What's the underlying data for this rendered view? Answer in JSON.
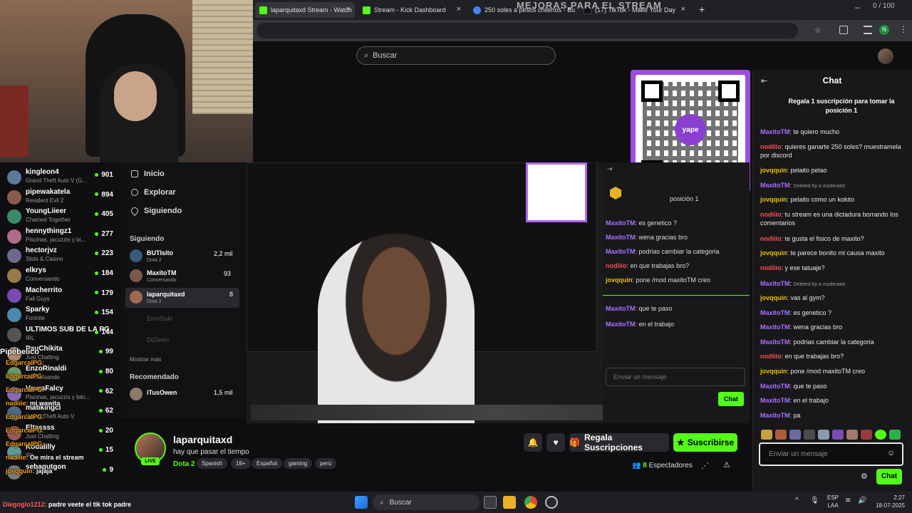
{
  "browser": {
    "tabs": [
      {
        "label": "laparquitaxd Stream - Watch",
        "color": "#53fc18"
      },
      {
        "label": "Stream - Kick Dashboard",
        "color": "#53fc18"
      },
      {
        "label": "250 soles a pesos chilenos - Bu",
        "color": "#4285f4"
      },
      {
        "label": "(17) TikTok - Make Your Day",
        "color": "#000000"
      }
    ],
    "overlay_text": "MEJORAS PARA EL STREAM",
    "window_counter": "0 / 100"
  },
  "kick": {
    "search_placeholder": "Buscar",
    "chat_title": "Chat",
    "pinned": "Regala 1 suscripción para tomar la posición 1",
    "pinned_rank": "1",
    "chat_messages": [
      {
        "user": "MaxitoTM",
        "color": "#a970ff",
        "text": "te quiero mucho"
      },
      {
        "user": "nodiiio",
        "color": "#ff4d4d",
        "text": "quieres ganarte 250 soles? muestramela por discord"
      },
      {
        "user": "jovqquin",
        "color": "#e8c200",
        "text": "pelaito pelao"
      },
      {
        "user": "MaxitoTM",
        "color": "#a970ff",
        "text": "Deleted by a moderator",
        "mod": true
      },
      {
        "user": "jovqquin",
        "color": "#e8c200",
        "text": "pelaito como un kokito"
      },
      {
        "user": "nodiiio",
        "color": "#ff4d4d",
        "text": "tu stream es una dictadura borrando los comentarios"
      },
      {
        "user": "nodiiio",
        "color": "#ff4d4d",
        "text": "te gusta el fisico de maxito?"
      },
      {
        "user": "jovqquin",
        "color": "#e8c200",
        "text": "te parece bonito mi causa maxito"
      },
      {
        "user": "nodiiio",
        "color": "#ff4d4d",
        "text": "y ese tatuaje?"
      },
      {
        "user": "MaxitoTM",
        "color": "#a970ff",
        "text": "Deleted by a moderator",
        "mod": true
      },
      {
        "user": "jovqquin",
        "color": "#e8c200",
        "text": "vas al gym?"
      },
      {
        "user": "MaxitoTM",
        "color": "#a970ff",
        "text": "es genetico ?"
      },
      {
        "user": "MaxitoTM",
        "color": "#a970ff",
        "text": "wena gracias bro"
      },
      {
        "user": "MaxitoTM",
        "color": "#a970ff",
        "text": "podrias cambiar la categoria"
      },
      {
        "user": "nodiiio",
        "color": "#ff4d4d",
        "text": "en que trabajas bro?"
      },
      {
        "user": "jovqquin",
        "color": "#e8c200",
        "text": "pone /mod maxitoTM creo"
      },
      {
        "user": "MaxitoTM",
        "color": "#a970ff",
        "text": "que te paso"
      },
      {
        "user": "MaxitoTM",
        "color": "#a970ff",
        "text": "en el trabajo"
      },
      {
        "user": "MaxitoTM",
        "color": "#a970ff",
        "text": "pa"
      }
    ],
    "chat_input_placeholder": "Enviar un mensaje",
    "chat_send_label": "Chat",
    "streamer": {
      "name": "laparquitaxd",
      "title": "hay que pasar el tiempo",
      "category": "Dota 2",
      "tags": [
        "Spanish",
        "18+",
        "Español",
        "gaming",
        "perú"
      ],
      "live": "LIVE",
      "viewers": "8",
      "viewers_label": "Espectadores"
    },
    "gift_label": "Regala Suscripciones",
    "subscribe_label": "Suscribirse",
    "nav": [
      "Inicio",
      "Explorar",
      "Siguiendo"
    ],
    "following_header": "Siguiendo",
    "following": [
      {
        "name": "BUTIsito",
        "sub": "Dota 2",
        "count": "2,2 mil"
      },
      {
        "name": "MaxitoTM",
        "sub": "Conversando",
        "count": "93"
      },
      {
        "name": "laparquitaxd",
        "sub": "Dota 2",
        "count": "8"
      }
    ],
    "offline": [
      "EmoSuki",
      "DiZeein"
    ],
    "show_more": "Mostrar más",
    "recommended_header": "Recomendado",
    "recommended": [
      {
        "name": "iTusOwen",
        "count": "1,5 mil"
      }
    ],
    "qr_position": "posición 1",
    "qr_logo": "yape"
  },
  "follow_list": [
    {
      "name": "kingleon4",
      "sub": "Grand Theft Auto V (G...",
      "count": "901",
      "color": "#5a7a9a"
    },
    {
      "name": "pipewakatela",
      "sub": "Resident Evil 2",
      "count": "894",
      "color": "#8a5a4a"
    },
    {
      "name": "YoungLiieer",
      "sub": "Chained Together",
      "count": "405",
      "color": "#3a8a6a"
    },
    {
      "name": "hennythingz1",
      "sub": "Piscinas, jacuzzis y bi...",
      "count": "277",
      "color": "#b06a8a"
    },
    {
      "name": "hectorjvz",
      "sub": "Slots & Casino",
      "count": "223",
      "color": "#6a6a8a"
    },
    {
      "name": "elkrys",
      "sub": "Conversando",
      "count": "184",
      "color": "#9a7a4a"
    },
    {
      "name": "Macherrito",
      "sub": "Fall Guys",
      "count": "179",
      "color": "#7a4ab0"
    },
    {
      "name": "Sparky",
      "sub": "Fortnite",
      "count": "154",
      "color": "#4a8ab0"
    },
    {
      "name": "ULTIMOS SUB DE LA PG",
      "sub": "IRL",
      "count": "144",
      "color": "#555555"
    },
    {
      "name": "PauChikita",
      "sub": "Just Chatting",
      "count": "99",
      "color": "#b08a6a"
    },
    {
      "name": "EnzoRinaldi",
      "sub": "Conversando",
      "count": "80",
      "color": "#6a9a6a"
    },
    {
      "name": "VauraFalcy",
      "sub": "Piscinas, jacuzzis y biki...",
      "count": "62",
      "color": "#8a6ab0"
    },
    {
      "name": "matikingcl",
      "sub": "Grand Theft Auto V",
      "count": "62",
      "color": "#4a6a8a"
    },
    {
      "name": "Eltassss",
      "sub": "Just Chatting",
      "count": "20",
      "color": "#9a5a5a"
    },
    {
      "name": "Kodalilly",
      "sub": "IRL",
      "count": "15",
      "color": "#5a9a9a"
    },
    {
      "name": "sebagutgon",
      "sub": "",
      "count": "9",
      "color": "#7a7a7a"
    }
  ],
  "overlay_chat": {
    "header": "Pipebelico",
    "lines": [
      {
        "user": "EdgarcaIPG:",
        "text": ""
      },
      {
        "user": "EdgarcaIPG:",
        "text": ""
      },
      {
        "user": "EdgarcaIPG:",
        "text": ""
      },
      {
        "user": "nadiiie:",
        "text": "mi wawita"
      },
      {
        "user": "EdgarcaIPG:",
        "text": ""
      },
      {
        "user": "EdgarcaIPG:",
        "text": ""
      },
      {
        "user": "EdgarcaIPG:",
        "text": ""
      },
      {
        "user": "nadiiie:",
        "text": "Oe mira el stream"
      },
      {
        "user": "jovqquin:",
        "text": "jajaja"
      }
    ],
    "bottom_user": "Diegogio1212:",
    "bottom_text": "padre veete el tik tok padre"
  },
  "taskbar": {
    "search": "Buscar",
    "lang_top": "ESP",
    "lang_bottom": "LAA",
    "time": "2:27",
    "date": "18-07-2025"
  }
}
